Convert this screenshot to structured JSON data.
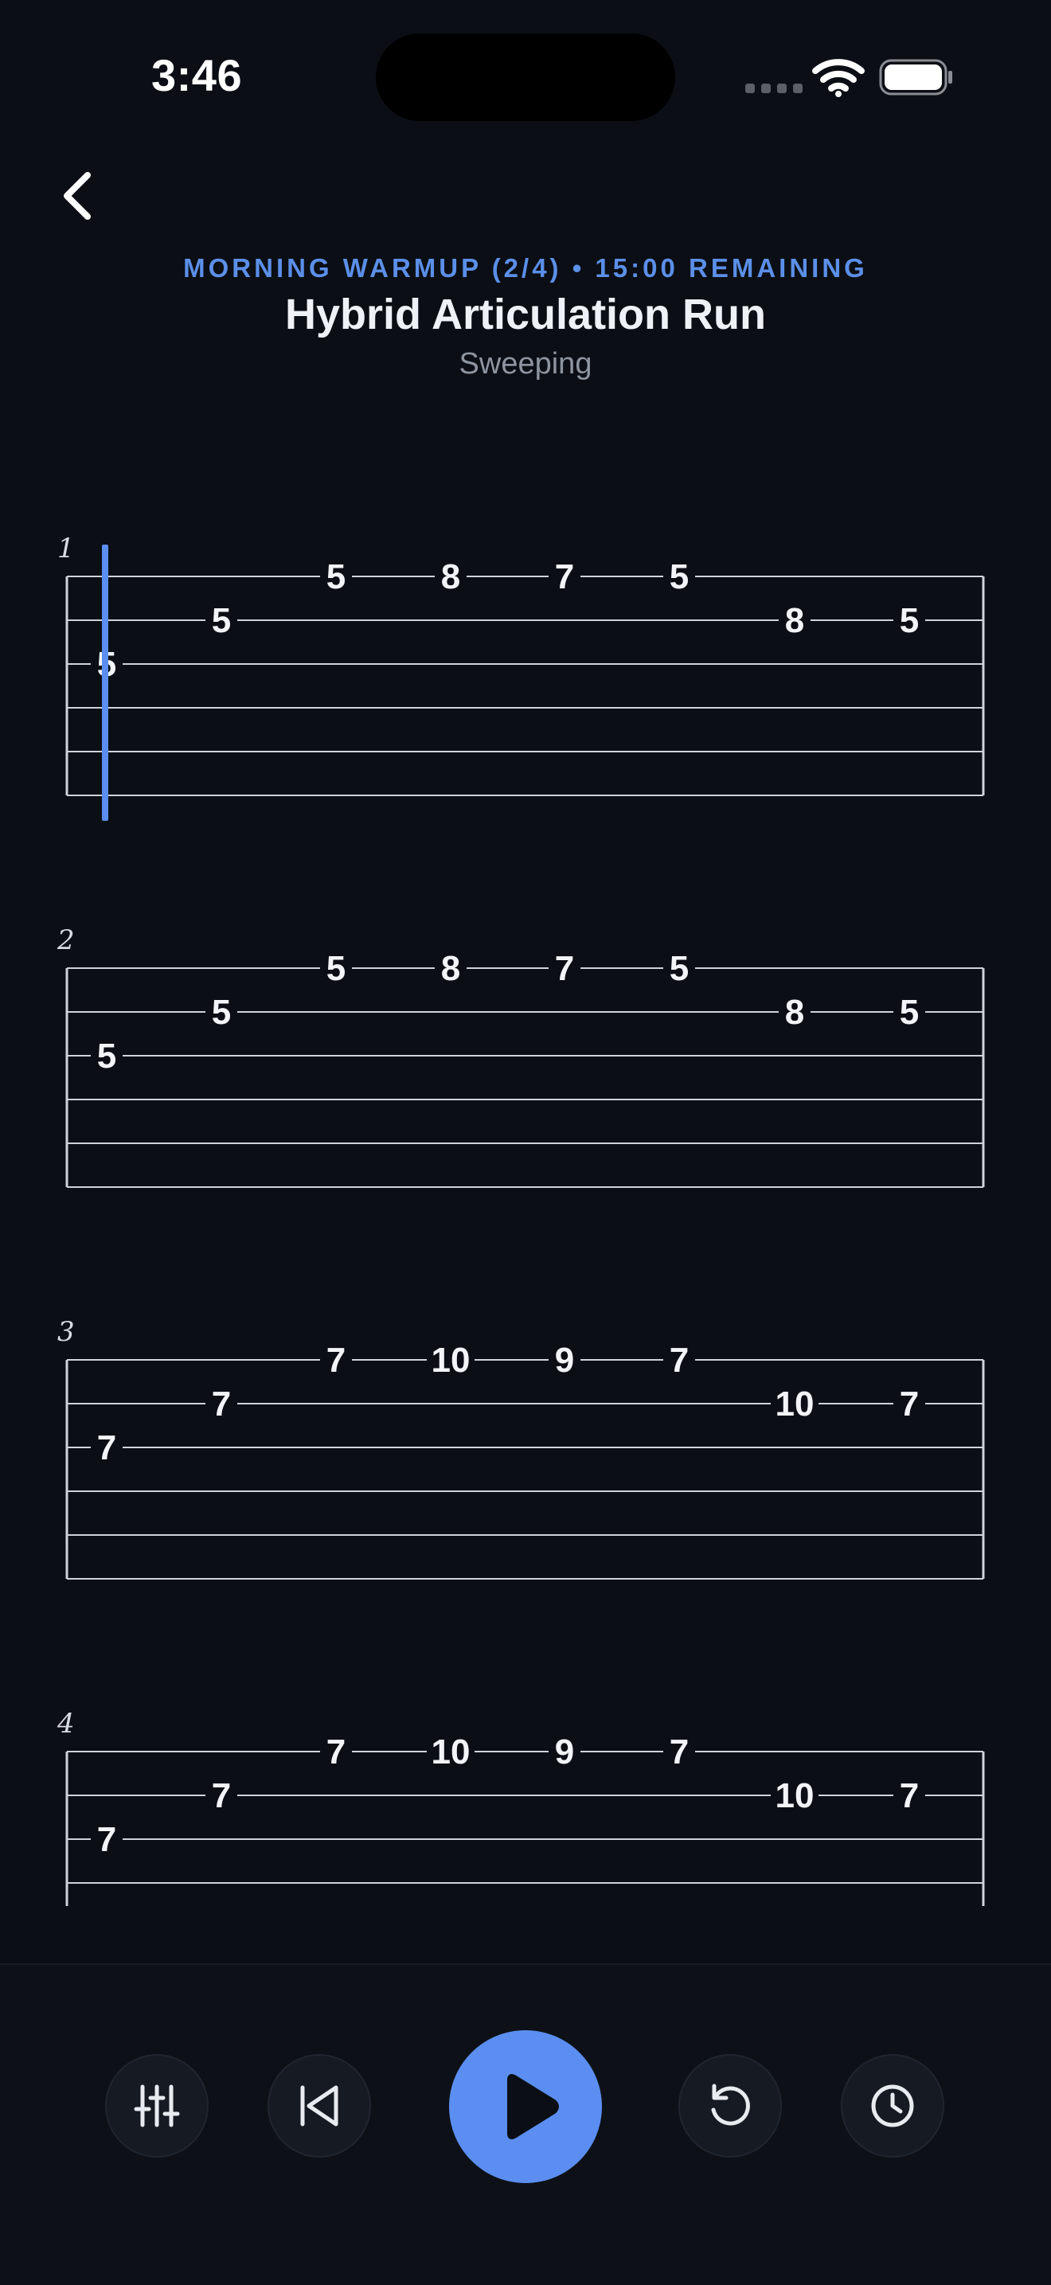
{
  "status_bar": {
    "time": "3:46"
  },
  "header": {
    "session_label": "MORNING WARMUP (2/4) • 15:00 REMAINING",
    "title": "Hybrid Articulation Run",
    "subtitle": "Sweeping"
  },
  "tab": {
    "playhead": {
      "measure": 1,
      "note_index": 0
    },
    "measures": [
      {
        "number": "1",
        "notes": [
          {
            "string": 3,
            "fret": "5"
          },
          {
            "string": 2,
            "fret": "5"
          },
          {
            "string": 1,
            "fret": "5"
          },
          {
            "string": 1,
            "fret": "8"
          },
          {
            "string": 1,
            "fret": "7"
          },
          {
            "string": 1,
            "fret": "5"
          },
          {
            "string": 2,
            "fret": "8"
          },
          {
            "string": 2,
            "fret": "5"
          }
        ]
      },
      {
        "number": "2",
        "notes": [
          {
            "string": 3,
            "fret": "5"
          },
          {
            "string": 2,
            "fret": "5"
          },
          {
            "string": 1,
            "fret": "5"
          },
          {
            "string": 1,
            "fret": "8"
          },
          {
            "string": 1,
            "fret": "7"
          },
          {
            "string": 1,
            "fret": "5"
          },
          {
            "string": 2,
            "fret": "8"
          },
          {
            "string": 2,
            "fret": "5"
          }
        ]
      },
      {
        "number": "3",
        "notes": [
          {
            "string": 3,
            "fret": "7"
          },
          {
            "string": 2,
            "fret": "7"
          },
          {
            "string": 1,
            "fret": "7"
          },
          {
            "string": 1,
            "fret": "10"
          },
          {
            "string": 1,
            "fret": "9"
          },
          {
            "string": 1,
            "fret": "7"
          },
          {
            "string": 2,
            "fret": "10"
          },
          {
            "string": 2,
            "fret": "7"
          }
        ]
      },
      {
        "number": "4",
        "notes": [
          {
            "string": 3,
            "fret": "7"
          },
          {
            "string": 2,
            "fret": "7"
          },
          {
            "string": 1,
            "fret": "7"
          },
          {
            "string": 1,
            "fret": "10"
          },
          {
            "string": 1,
            "fret": "9"
          },
          {
            "string": 1,
            "fret": "7"
          },
          {
            "string": 2,
            "fret": "10"
          },
          {
            "string": 2,
            "fret": "7"
          }
        ]
      }
    ]
  },
  "controls": {
    "mixer_icon": "sliders-icon",
    "prev_icon": "skip-back-icon",
    "play_icon": "play-icon",
    "loop_icon": "restart-icon",
    "timer_icon": "clock-icon"
  },
  "colors": {
    "accent": "#5b8ef0",
    "background": "#0b0e14",
    "tab_line": "#cfd3da",
    "playhead": "#5b8ef0"
  }
}
